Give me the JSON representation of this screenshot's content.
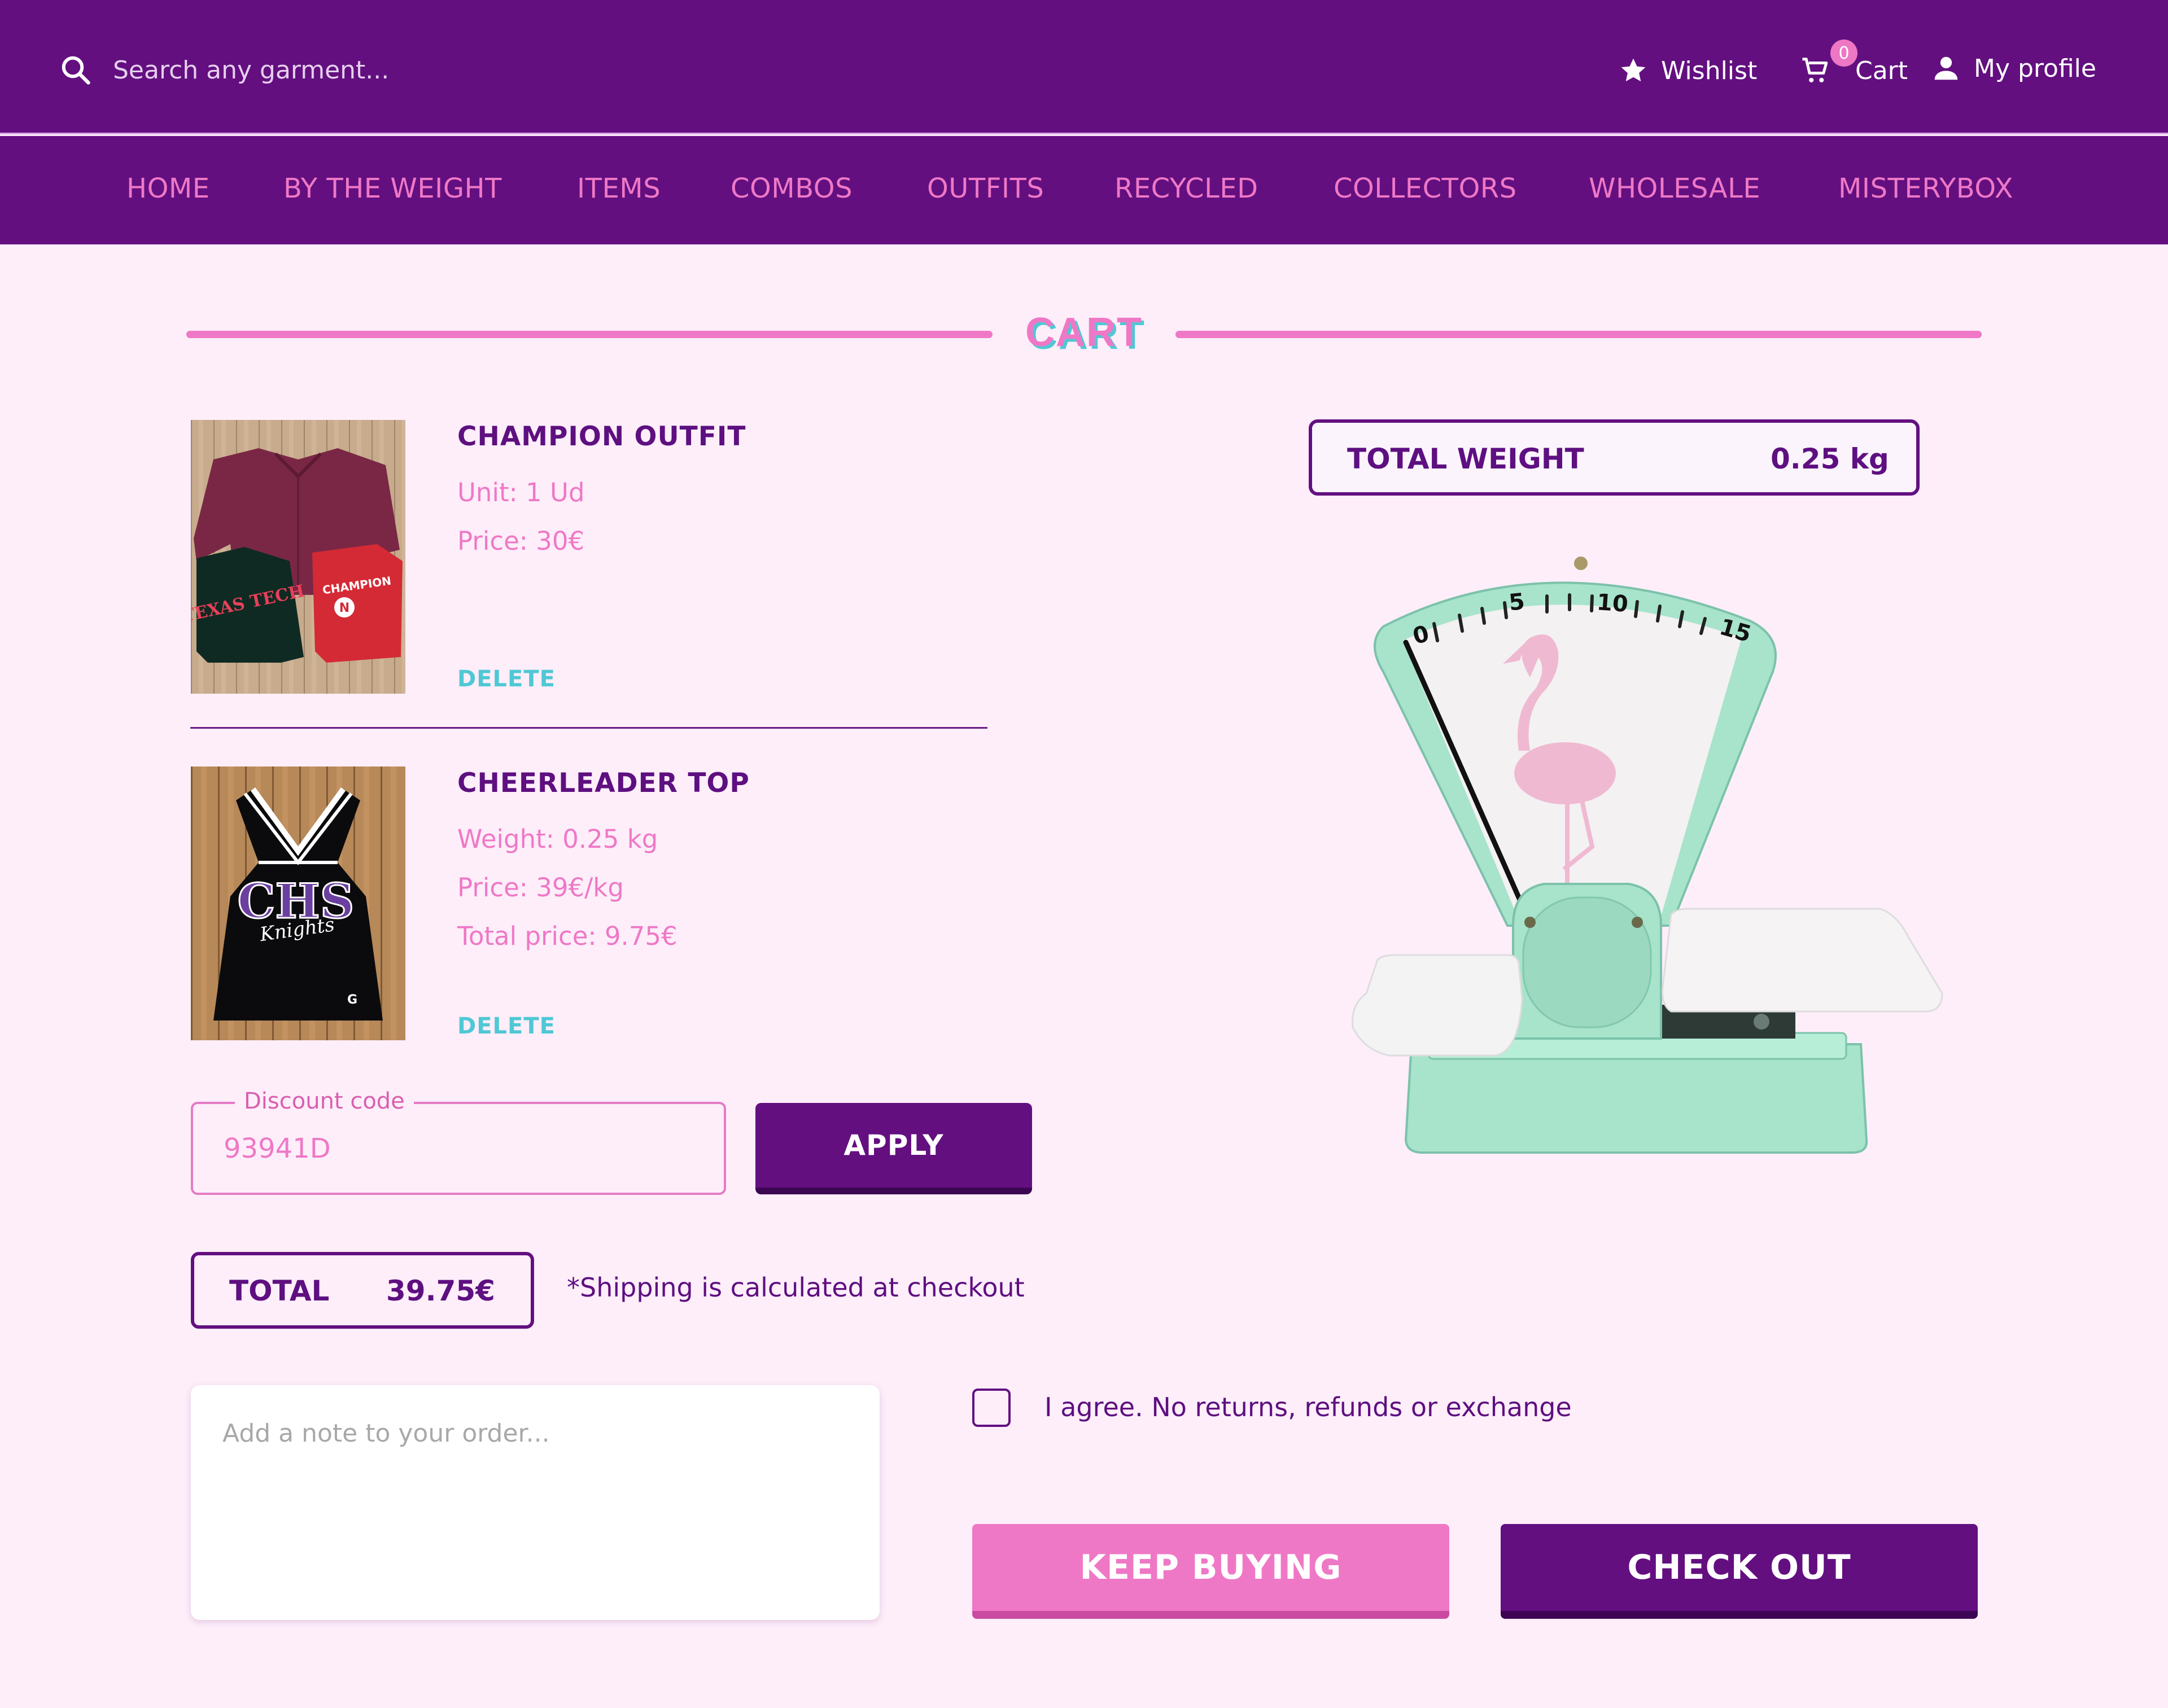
{
  "header": {
    "search_placeholder": "Search any garment...",
    "wishlist_label": "Wishlist",
    "cart_label": "Cart",
    "cart_count": "0",
    "profile_label": "My profile"
  },
  "nav": {
    "items": [
      "HOME",
      "BY THE WEIGHT",
      "ITEMS",
      "COMBOS",
      "OUTFITS",
      "RECYCLED",
      "COLLECTORS",
      "WHOLESALE",
      "MISTERYBOX"
    ]
  },
  "page_title": "CART",
  "products": [
    {
      "name": "CHAMPION OUTFIT",
      "details": [
        "Unit: 1 Ud",
        "Price: 30€"
      ],
      "delete_label": "DELETE",
      "image_text": [
        "TEXAS TECH",
        "CHAMPION",
        "N"
      ]
    },
    {
      "name": "CHEERLEADER TOP",
      "details": [
        "Weight: 0.25 kg",
        "Price: 39€/kg",
        "Total price: 9.75€"
      ],
      "delete_label": "DELETE",
      "image_text": [
        "CHS",
        "Knights",
        "G"
      ]
    }
  ],
  "discount": {
    "legend": "Discount code",
    "value": "93941D",
    "apply_label": "APPLY"
  },
  "total": {
    "label": "TOTAL",
    "value": "39.75€",
    "shipping_note": "*Shipping is calculated at checkout"
  },
  "note": {
    "placeholder": "Add a note to your order..."
  },
  "agree": {
    "label": "I agree. No returns, refunds or exchange",
    "checked": false
  },
  "buttons": {
    "keep_buying": "KEEP BUYING",
    "check_out": "CHECK OUT"
  },
  "weight": {
    "label": "TOTAL WEIGHT",
    "value": "0.25 kg"
  },
  "scale": {
    "dial_labels": [
      "0",
      "5",
      "10",
      "15"
    ]
  },
  "colors": {
    "primary_purple": "#630f80",
    "accent_pink": "#ef78c6",
    "accent_teal": "#4fc8d4",
    "background": "#fdeefa",
    "scale_mint": "#a8e3cc"
  }
}
